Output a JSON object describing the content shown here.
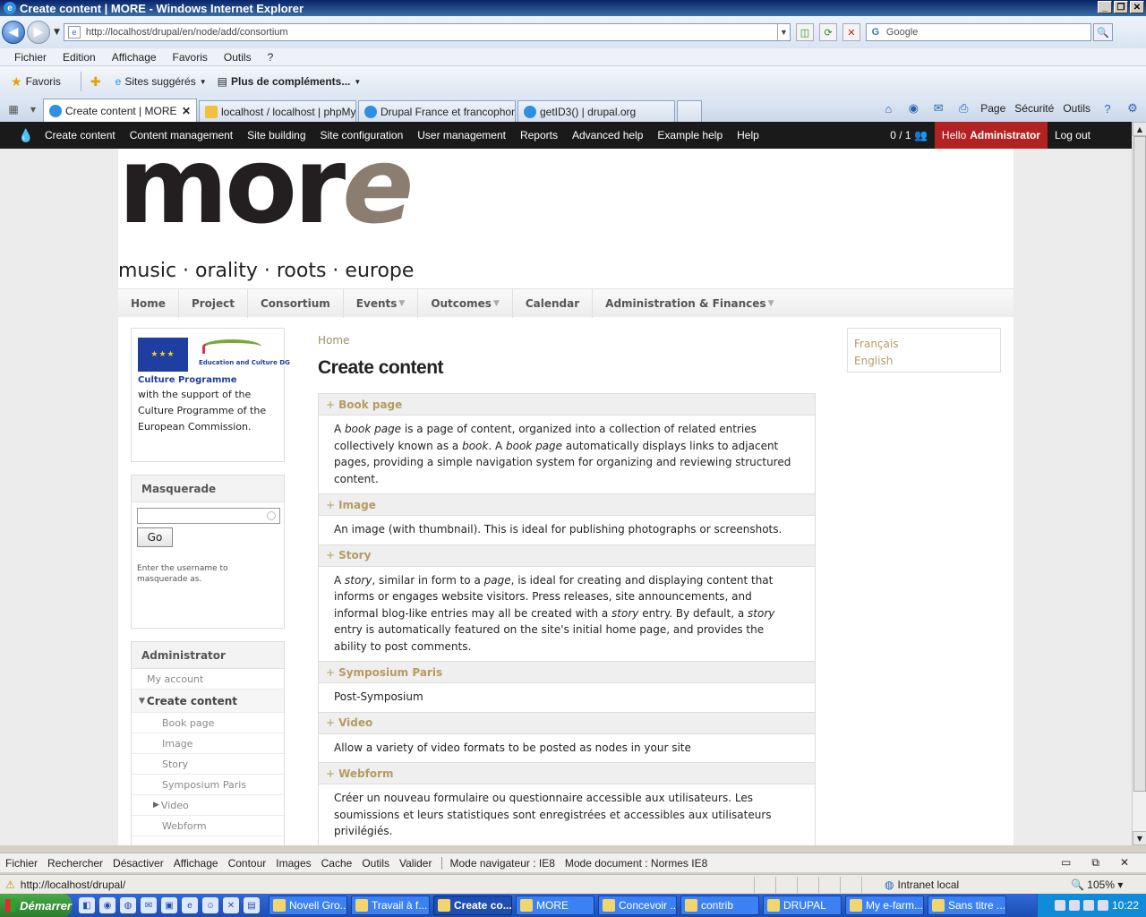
{
  "window": {
    "title": "Create content | MORE - Windows Internet Explorer"
  },
  "address_bar": {
    "url": "http://localhost/drupal/en/node/add/consortium",
    "search_placeholder": "Google"
  },
  "ie_menu": [
    "Fichier",
    "Edition",
    "Affichage",
    "Favoris",
    "Outils",
    "?"
  ],
  "favorites_bar": {
    "favorites": "Favoris",
    "suggested": "Sites suggérés",
    "more_addons": "Plus de compléments..."
  },
  "tabs": [
    {
      "label": "Create content | MORE",
      "active": true
    },
    {
      "label": "localhost / localhost | phpMy...",
      "active": false
    },
    {
      "label": "Drupal France et francophonie",
      "active": false
    },
    {
      "label": "getID3() | drupal.org",
      "active": false
    }
  ],
  "command_bar": {
    "page": "Page",
    "security": "Sécurité",
    "tools": "Outils"
  },
  "admin_menu": {
    "items": [
      "Create content",
      "Content management",
      "Site building",
      "Site configuration",
      "User management",
      "Reports",
      "Advanced help",
      "Example help",
      "Help"
    ],
    "user_count": "0 / 1",
    "hello": "Hello",
    "username": "Administrator",
    "logout": "Log out"
  },
  "logo": {
    "word_prefix": "mor",
    "word_suffix": "e",
    "tagline": "music · orality · roots · europe"
  },
  "primary_nav": [
    {
      "label": "Home",
      "has_children": false
    },
    {
      "label": "Project",
      "has_children": false
    },
    {
      "label": "Consortium",
      "has_children": false
    },
    {
      "label": "Events",
      "has_children": true
    },
    {
      "label": "Outcomes",
      "has_children": true
    },
    {
      "label": "Calendar",
      "has_children": false
    },
    {
      "label": "Administration & Finances",
      "has_children": true
    }
  ],
  "sponsor_block": {
    "logo_caption": "Education and Culture DG",
    "programme": "Culture Programme",
    "text": "with the support of the Culture Programme of the European Commission."
  },
  "masquerade_block": {
    "title": "Masquerade",
    "input_value": "",
    "button": "Go",
    "help": "Enter the username to masquerade as."
  },
  "user_block": {
    "title": "Administrator",
    "items": [
      {
        "label": "My account",
        "level": 1,
        "active": false
      },
      {
        "label": "Create content",
        "level": 0,
        "active": true
      },
      {
        "label": "Book page",
        "level": 2,
        "active": false
      },
      {
        "label": "Image",
        "level": 2,
        "active": false
      },
      {
        "label": "Story",
        "level": 2,
        "active": false
      },
      {
        "label": "Symposium Paris",
        "level": 2,
        "active": false
      },
      {
        "label": "Video",
        "level": 2,
        "active": false,
        "collapsed": true
      },
      {
        "label": "Webform",
        "level": 2,
        "active": false
      }
    ]
  },
  "main": {
    "breadcrumb": "Home",
    "title": "Create content",
    "content_types": [
      {
        "name": "Book page",
        "description_html": "A <em>book page</em> is a page of content, organized into a collection of related entries collectively known as a <em>book</em>. A <em>book page</em> automatically displays links to adjacent pages, providing a simple navigation system for organizing and reviewing structured content."
      },
      {
        "name": "Image",
        "description_html": "An image (with thumbnail). This is ideal for publishing photographs or screenshots."
      },
      {
        "name": "Story",
        "description_html": "A <em>story</em>, similar in form to a <em>page</em>, is ideal for creating and displaying content that informs or engages website visitors. Press releases, site announcements, and informal blog-like entries may all be created with a <em>story</em> entry. By default, a <em>story</em> entry is automatically featured on the site's initial home page, and provides the ability to post comments."
      },
      {
        "name": "Symposium Paris",
        "description_html": "Post-Symposium"
      },
      {
        "name": "Video",
        "description_html": "Allow a variety of video formats to be posted as nodes in your site"
      },
      {
        "name": "Webform",
        "description_html": "Créer un nouveau formulaire ou questionnaire accessible aux utilisateurs. Les soumissions et leurs statistiques sont enregistrées et accessibles aux utilisateurs privilégiés."
      }
    ]
  },
  "language_block": [
    "Français",
    "English"
  ],
  "dev_toolbar": {
    "items": [
      "Fichier",
      "Rechercher",
      "Désactiver",
      "Affichage",
      "Contour",
      "Images",
      "Cache",
      "Outils",
      "Valider"
    ],
    "browser_mode": "Mode navigateur : IE8",
    "document_mode": "Mode document : Normes IE8"
  },
  "status_bar": {
    "url": "http://localhost/drupal/",
    "zone": "Intranet local",
    "zoom": "105%"
  },
  "taskbar": {
    "start": "Démarrer",
    "tasks": [
      {
        "label": "Novell Gro...",
        "active": false
      },
      {
        "label": "Travail à f...",
        "active": false
      },
      {
        "label": "Create co...",
        "active": true
      },
      {
        "label": "MORE",
        "active": false
      },
      {
        "label": "Concevoir ...",
        "active": false
      },
      {
        "label": "contrib",
        "active": false
      },
      {
        "label": "DRUPAL",
        "active": false
      },
      {
        "label": "My e-farm...",
        "active": false
      },
      {
        "label": "Sans titre ...",
        "active": false
      }
    ],
    "clock": "10:22"
  }
}
